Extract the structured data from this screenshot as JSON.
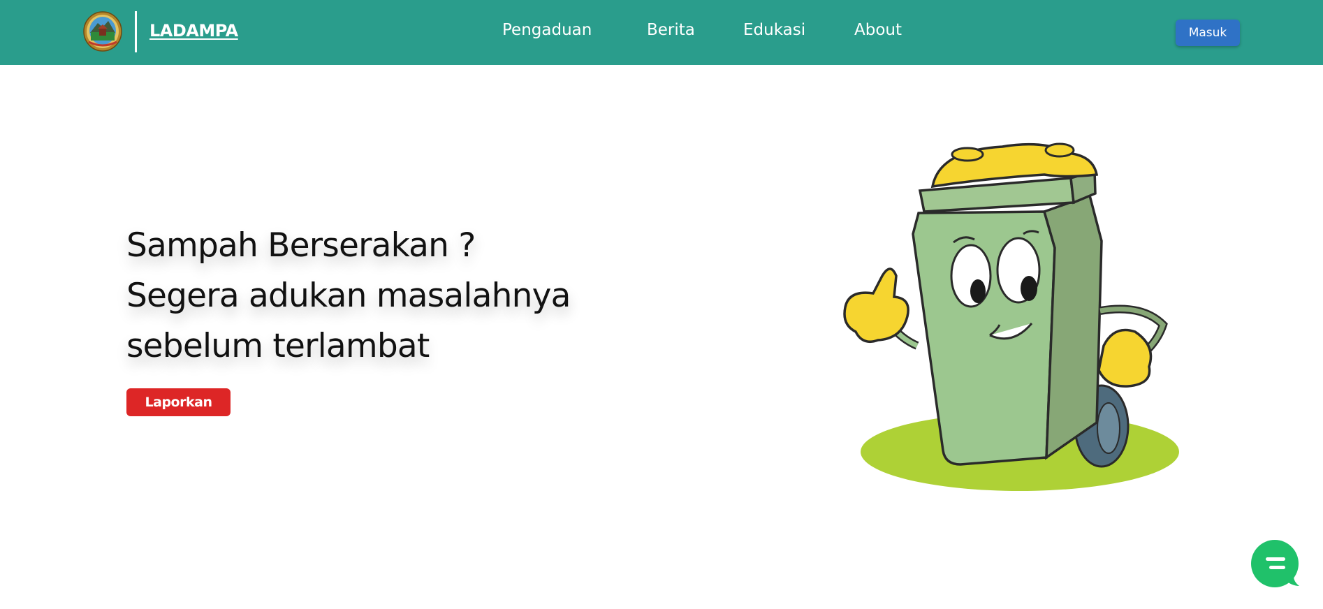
{
  "header": {
    "brand": "LADAMPA",
    "nav": [
      {
        "label": "Pengaduan"
      },
      {
        "label": "Berita"
      },
      {
        "label": "Edukasi"
      },
      {
        "label": "About"
      }
    ],
    "login_label": "Masuk"
  },
  "hero": {
    "headline_lines": [
      "Sampah Berserakan ?",
      "Segera adukan masalahnya",
      "sebelum terlambat"
    ],
    "cta_label": "Laporkan"
  },
  "colors": {
    "navbar": "#2a9d8c",
    "login_button": "#2f72c6",
    "cta_button": "#dd2626",
    "chat_button": "#20c16a"
  },
  "icons": {
    "emblem": "regency-emblem-icon",
    "mascot": "trash-bin-mascot",
    "chat": "chat-bubble-icon"
  }
}
